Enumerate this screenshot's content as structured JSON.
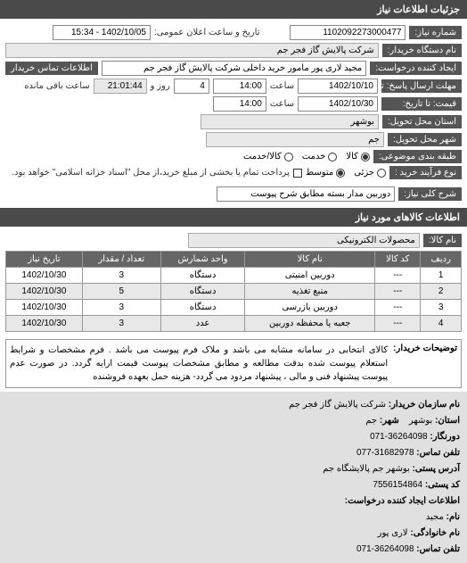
{
  "header_title": "جزئیات اطلاعات نیاز",
  "request_number_label": "شماره نیاز:",
  "request_number": "1102092273000477",
  "public_datetime_label": "تاریخ و ساعت اعلان عمومی:",
  "public_datetime": "1402/10/05 - 15:34",
  "buyer_org_label": "نام دستگاه خریدار:",
  "buyer_org": "شرکت پالایش گاز فجر جم",
  "creator_label": "ایجاد کننده درخواست:",
  "creator": "مجید  لاری پور مامور خرید داخلی شرکت پالایش گاز فجر جم",
  "buyer_contact_label": "اطلاعات تماس خریدار",
  "response_deadline_label": "مهلت ارسال پاسخ: تا تاریخ:",
  "response_deadline_date": "1402/10/10",
  "time_label": "ساعت",
  "response_deadline_time": "14:00",
  "days_label": "روز و",
  "days_value": "4",
  "remaining_time": "21:01:44",
  "remaining_time_label": "ساعت باقی مانده",
  "price_until_label": "قیمت: تا تاریخ:",
  "price_until_date": "1402/10/30",
  "price_until_time": "14:00",
  "delivery_province_label": "استان محل تحویل:",
  "delivery_province": "بوشهر",
  "delivery_city_label": "شهر محل تحویل:",
  "delivery_city": "جم",
  "budget_class_label": "طبقه بندی موضوعی:",
  "budget_options": {
    "goods": "کالا",
    "service": "خدمت",
    "goods_service": "کالا/خدمت"
  },
  "buy_type_label": "نوع فرآیند خرید :",
  "buy_type_opts": {
    "low": "جزئی",
    "mid": "متوسط"
  },
  "buy_type_note": "پرداخت تمام یا بخشی از مبلغ خرید،از محل \"اسناد خزانه اسلامی\" خواهد بود.",
  "need_title_label": "شرح کلی نیاز:",
  "need_title": "دوربین مدار بسته مطابق شرح پیوست",
  "goods_section_title": "اطلاعات کالاهای مورد نیاز",
  "goods_name_label": "نام کالا:",
  "goods_name": "محصولات الکترونیکی",
  "table_headers": {
    "row": "ردیف",
    "code": "کد کالا",
    "name": "نام کالا",
    "unit": "واحد شمارش",
    "qty": "تعداد / مقدار",
    "date": "تاریخ نیاز"
  },
  "table_rows": [
    {
      "row": "1",
      "code": "---",
      "name": "دوربین امنیتی",
      "unit": "دستگاه",
      "qty": "3",
      "date": "1402/10/30"
    },
    {
      "row": "2",
      "code": "---",
      "name": "منبع تغذیه",
      "unit": "دستگاه",
      "qty": "5",
      "date": "1402/10/30"
    },
    {
      "row": "3",
      "code": "---",
      "name": "دوربین بازرسی",
      "unit": "دستگاه",
      "qty": "3",
      "date": "1402/10/30"
    },
    {
      "row": "4",
      "code": "---",
      "name": "جعبه یا محفظه دوربین",
      "unit": "عدد",
      "qty": "3",
      "date": "1402/10/30"
    }
  ],
  "desc_label": "توضیحات خریدار:",
  "desc_text": "کالای انتخابی در سامانه مشابه می باشد و ملاک فرم پیوست می باشد . فرم مشخصات و شرایط استعلام پیوست شده بدقت مطالعه و مطابق مشخصات پیوست قیمت ارایه گردد. در صورت عدم پیوست پیشنهاد فنی و مالی ، پیشنهاد مردود می گردد- هزینه حمل بعهده فروشنده",
  "footer": {
    "org_name_label": "نام سازمان خریدار:",
    "org_name": "شرکت پالایش گاز فجر جم",
    "province_label": "استان:",
    "province": "بوشهر",
    "city_label": "شهر:",
    "city": "جم",
    "fax_label": "دورنگار:",
    "fax": "36264098-071",
    "phone_label": "تلفن تماس:",
    "phone": "31682978-077",
    "address_label": "آدرس پستی:",
    "address": "بوشهر جم پالایشگاه جم",
    "postal_label": "کد پستی:",
    "postal": "7556154864",
    "creator_info_label": "اطلاعات ایجاد کننده درخواست:",
    "fname_label": "نام:",
    "fname": "مجید",
    "lname_label": "نام خانوادگی:",
    "lname": "لاری پور",
    "cphone_label": "تلفن تماس:",
    "cphone": "36264098-071"
  }
}
